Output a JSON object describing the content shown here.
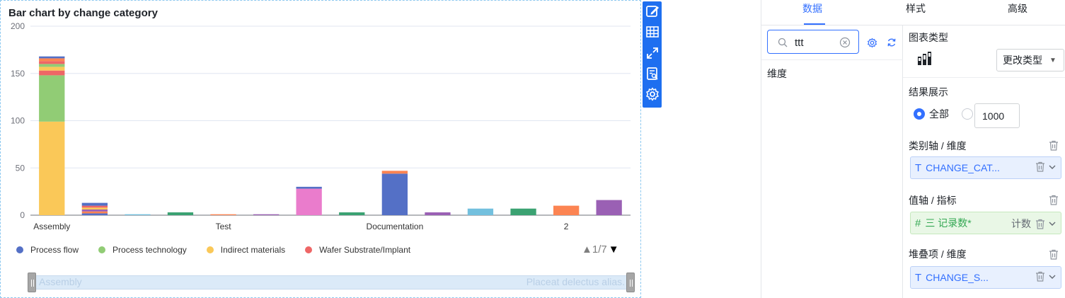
{
  "chart_data": {
    "type": "bar",
    "stacked": true,
    "title": "Bar chart by change category",
    "ylim": [
      0,
      200
    ],
    "yticks": [
      0,
      50,
      100,
      150,
      200
    ],
    "grid": true,
    "category_labels": [
      "Assembly",
      "Test",
      "Documentation",
      "2"
    ],
    "colors": {
      "Process flow": "#5470c6",
      "Process technology": "#91cc75",
      "Indirect materials": "#fac858",
      "Wafer Substrate/Implant": "#ee6666"
    },
    "bars": [
      {
        "stack": [
          {
            "series": "Indirect materials",
            "value": 99
          },
          {
            "series": "Process technology",
            "value": 49
          },
          {
            "series": "Wafer Substrate/Implant",
            "value": 5
          },
          {
            "series": "other",
            "value": 4,
            "color": "#fac858"
          },
          {
            "series": "other",
            "value": 3,
            "color": "#91cc75"
          },
          {
            "series": "other",
            "value": 3,
            "color": "#ee6666"
          },
          {
            "series": "other",
            "value": 3,
            "color": "#fc8452"
          },
          {
            "series": "other",
            "value": 2,
            "color": "#5470c6"
          }
        ]
      },
      {
        "stack": [
          {
            "series": "Process flow",
            "value": 2
          },
          {
            "series": "other",
            "value": 2,
            "color": "#fc8452"
          },
          {
            "series": "other",
            "value": 2,
            "color": "#9a60b4"
          },
          {
            "series": "other",
            "value": 2,
            "color": "#fac858"
          },
          {
            "series": "other",
            "value": 2,
            "color": "#ee6666"
          },
          {
            "series": "other",
            "value": 3,
            "color": "#5470c6"
          }
        ]
      },
      {
        "stack": [
          {
            "series": "other",
            "value": 1,
            "color": "#73c0de"
          }
        ]
      },
      {
        "stack": [
          {
            "series": "other",
            "value": 3,
            "color": "#3ba272"
          }
        ]
      },
      {
        "stack": [
          {
            "series": "other",
            "value": 1,
            "color": "#fc8452"
          }
        ]
      },
      {
        "stack": [
          {
            "series": "other",
            "value": 1,
            "color": "#9a60b4"
          }
        ]
      },
      {
        "stack": [
          {
            "series": "other",
            "value": 28,
            "color": "#ea7ccc"
          },
          {
            "series": "other",
            "value": 2,
            "color": "#5470c6"
          }
        ]
      },
      {
        "stack": [
          {
            "series": "other",
            "value": 3,
            "color": "#3ba272"
          }
        ]
      },
      {
        "stack": [
          {
            "series": "Process flow",
            "value": 44
          },
          {
            "series": "other",
            "value": 3,
            "color": "#fc8452"
          }
        ]
      },
      {
        "stack": [
          {
            "series": "other",
            "value": 3,
            "color": "#9a60b4"
          }
        ]
      },
      {
        "stack": [
          {
            "series": "other",
            "value": 7,
            "color": "#73c0de"
          }
        ]
      },
      {
        "stack": [
          {
            "series": "other",
            "value": 7,
            "color": "#3ba272"
          }
        ]
      },
      {
        "stack": [
          {
            "series": "other",
            "value": 10,
            "color": "#fc8452"
          }
        ]
      },
      {
        "stack": [
          {
            "series": "other",
            "value": 16,
            "color": "#9a60b4"
          }
        ]
      }
    ],
    "legend": [
      {
        "name": "Process flow",
        "color": "#5470c6"
      },
      {
        "name": "Process technology",
        "color": "#91cc75"
      },
      {
        "name": "Indirect materials",
        "color": "#fac858"
      },
      {
        "name": "Wafer Substrate/Implant",
        "color": "#ee6666"
      }
    ],
    "legend_placement": "bottom-left"
  },
  "legend_pager": {
    "up": "▲",
    "text": "1/7",
    "down": "▼"
  },
  "zoom": {
    "start_label": "Assembly",
    "end_label": "Placeat delectus alias."
  },
  "toolbar": {
    "icons": [
      "edit-icon",
      "table-icon",
      "expand-icon",
      "data-view-icon",
      "gear-icon"
    ],
    "accent": "#1e6ff0"
  },
  "tabs": [
    {
      "label": "数据",
      "active": true
    },
    {
      "label": "样式",
      "active": false
    },
    {
      "label": "高级",
      "active": false
    }
  ],
  "field_panel": {
    "search_value": "ttt",
    "dimension_label": "维度"
  },
  "props": {
    "chart_type_label": "图表类型",
    "change_type_label": "更改类型",
    "result_label": "结果展示",
    "radio_all": "全部",
    "limit_value": "1000",
    "category_axis_label": "类别轴 / 维度",
    "category_chip": {
      "type": "T",
      "text": "CHANGE_CAT..."
    },
    "value_axis_label": "值轴 / 指标",
    "value_chip": {
      "type": "#",
      "text": "三 记录数*",
      "agg": "计数"
    },
    "stack_label": "堆叠项 / 维度",
    "stack_chip": {
      "type": "T",
      "text": "CHANGE_S..."
    }
  }
}
